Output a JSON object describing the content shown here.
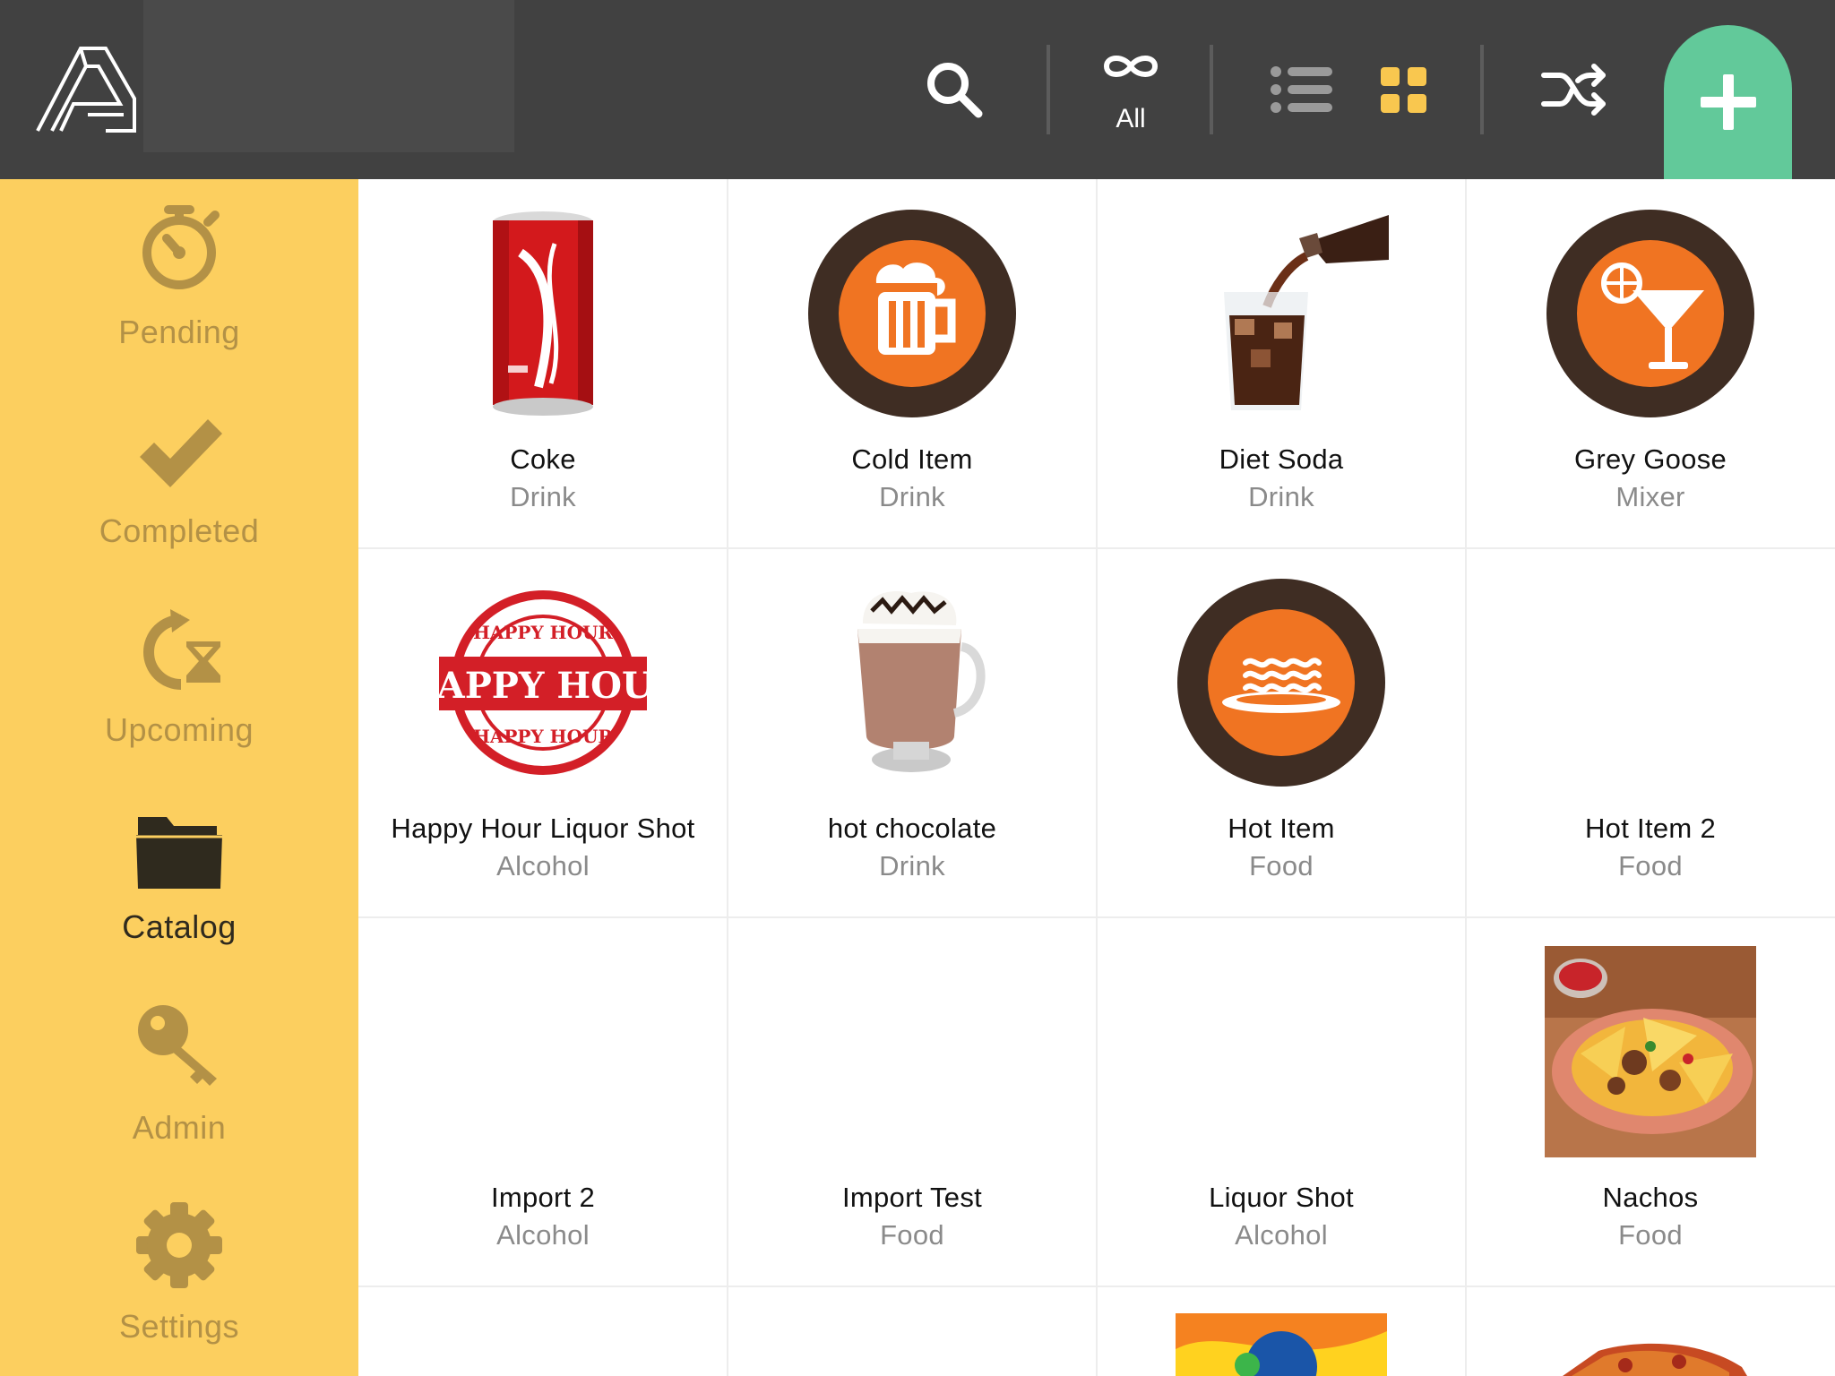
{
  "header": {
    "filter_label": "All"
  },
  "sidebar": {
    "items": [
      {
        "label": "Pending",
        "icon": "stopwatch-icon",
        "active": false
      },
      {
        "label": "Completed",
        "icon": "checkmark-icon",
        "active": false
      },
      {
        "label": "Upcoming",
        "icon": "refresh-hourglass-icon",
        "active": false
      },
      {
        "label": "Catalog",
        "icon": "folder-icon",
        "active": true
      },
      {
        "label": "Admin",
        "icon": "key-icon",
        "active": false
      },
      {
        "label": "Settings",
        "icon": "gear-icon",
        "active": false
      }
    ]
  },
  "catalog": {
    "items": [
      {
        "name": "Coke",
        "category": "Drink",
        "image": "coke-can-photo"
      },
      {
        "name": "Cold Item",
        "category": "Drink",
        "image": "beer-mug-icon"
      },
      {
        "name": "Diet Soda",
        "category": "Drink",
        "image": "soda-pour-photo"
      },
      {
        "name": "Grey Goose",
        "category": "Mixer",
        "image": "cocktail-glass-icon"
      },
      {
        "name": "Happy Hour Liquor Shot",
        "category": "Alcohol",
        "image": "happy-hour-stamp"
      },
      {
        "name": "hot chocolate",
        "category": "Drink",
        "image": "hot-chocolate-photo"
      },
      {
        "name": "Hot Item",
        "category": "Food",
        "image": "hot-plate-icon"
      },
      {
        "name": "Hot Item 2",
        "category": "Food",
        "image": ""
      },
      {
        "name": "Import 2",
        "category": "Alcohol",
        "image": ""
      },
      {
        "name": "Import Test",
        "category": "Food",
        "image": ""
      },
      {
        "name": "Liquor Shot",
        "category": "Alcohol",
        "image": ""
      },
      {
        "name": "Nachos",
        "category": "Food",
        "image": "nachos-photo"
      },
      {
        "name": "",
        "category": "",
        "image": ""
      },
      {
        "name": "",
        "category": "",
        "image": ""
      },
      {
        "name": "",
        "category": "",
        "image": "fanta-photo"
      },
      {
        "name": "",
        "category": "",
        "image": "pizza-photo"
      }
    ]
  },
  "colors": {
    "topbar": "#414141",
    "sidebar": "#fccf5f",
    "accent_green": "#62c99a",
    "accent_yellow": "#f9c74f",
    "icon_orange": "#f07422",
    "icon_ring": "#3f2d23",
    "sidebar_muted": "#b39146"
  }
}
